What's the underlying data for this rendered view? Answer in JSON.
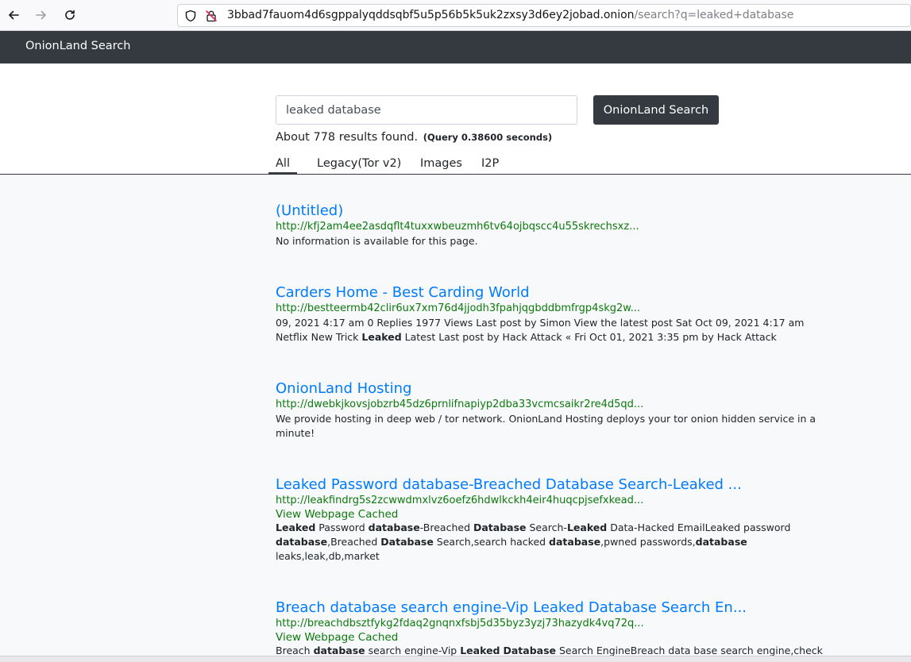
{
  "browser": {
    "url_host": "3bbad7fauom4d6sgppalyqddsqbf5u5p56b5k5uk2zxsy3d6ey2jobad.onion",
    "url_path": "/search?q=leaked+database"
  },
  "navbar": {
    "brand": "OnionLand Search"
  },
  "search": {
    "query": "leaked database",
    "button_label": "OnionLand Search",
    "stats": "About 778 results found.",
    "query_time": "(Query 0.38600 seconds)"
  },
  "tabs": [
    {
      "label": "All",
      "active": true
    },
    {
      "label": "Legacy(Tor v2)",
      "active": false
    },
    {
      "label": "Images",
      "active": false
    },
    {
      "label": "I2P",
      "active": false
    }
  ],
  "results": [
    {
      "title": "(Untitled)",
      "url": "http://kfj2am4ee2asdqflt4tuxxwbeuzmh6tv64ojbqscc4u55skrechsxz...",
      "cached": "",
      "desc": [
        [
          [
            "No information is available for this page.",
            false
          ]
        ]
      ]
    },
    {
      "title": "Carders Home - Best Carding World",
      "url": "http://bestteermb42clir6ux7xm76d4jjodh3fpahjqgbddbmfrgp4skg2w...",
      "cached": "",
      "desc": [
        [
          [
            "09, 2021 4:17 am 0 Replies 1977 Views Last post by Simon View the latest post Sat Oct 09, 2021 4:17 am",
            false
          ]
        ],
        [
          [
            "Netflix New Trick ",
            false
          ],
          [
            "Leaked",
            true
          ],
          [
            " Latest Last post by Hack Attack « Fri Oct 01, 2021 3:35 pm by Hack Attack",
            false
          ]
        ]
      ]
    },
    {
      "title": "OnionLand Hosting",
      "url": "http://dwebkjkovsjobzrb45dz6prnlifnapiyp2dba33vcmcsaikr2re4d5qd...",
      "cached": "",
      "desc": [
        [
          [
            "We provide hosting in deep web / tor network. OnionLand Hosting deploys your tor onion hidden service in a",
            false
          ]
        ],
        [
          [
            "minute!",
            false
          ]
        ]
      ]
    },
    {
      "title": "Leaked Password database-Breached Database Search-Leaked ...",
      "url": "http://leakfindrg5s2zcwwdmxlvz6oefz6hdwlkckh4eir4huqcpjsefxkead...",
      "cached": "View Webpage Cached",
      "desc": [
        [
          [
            "Leaked",
            true
          ],
          [
            " Password ",
            false
          ],
          [
            "database",
            true
          ],
          [
            "-Breached ",
            false
          ],
          [
            "Database",
            true
          ],
          [
            " Search-",
            false
          ],
          [
            "Leaked",
            true
          ],
          [
            " Data-Hacked EmailLeaked password",
            false
          ]
        ],
        [
          [
            "database",
            true
          ],
          [
            ",Breached ",
            false
          ],
          [
            "Database",
            true
          ],
          [
            " Search,search hacked ",
            false
          ],
          [
            "database",
            true
          ],
          [
            ",pwned passwords,",
            false
          ],
          [
            "database",
            true
          ]
        ],
        [
          [
            "leaks,leak,db,market",
            false
          ]
        ]
      ]
    },
    {
      "title": "Breach database search engine-Vip Leaked Database Search En...",
      "url": "http://breachdbsztfykg2fdaq2gnqnxfsbj5d35byz3yzj73hazydk4vq72q...",
      "cached": "View Webpage Cached",
      "desc": [
        [
          [
            "Breach ",
            false
          ],
          [
            "database",
            true
          ],
          [
            " search engine-Vip ",
            false
          ],
          [
            "Leaked",
            true
          ],
          [
            " ",
            false
          ],
          [
            "Database",
            true
          ],
          [
            " Search EngineBreach data base search engine,check",
            false
          ]
        ]
      ]
    }
  ]
}
